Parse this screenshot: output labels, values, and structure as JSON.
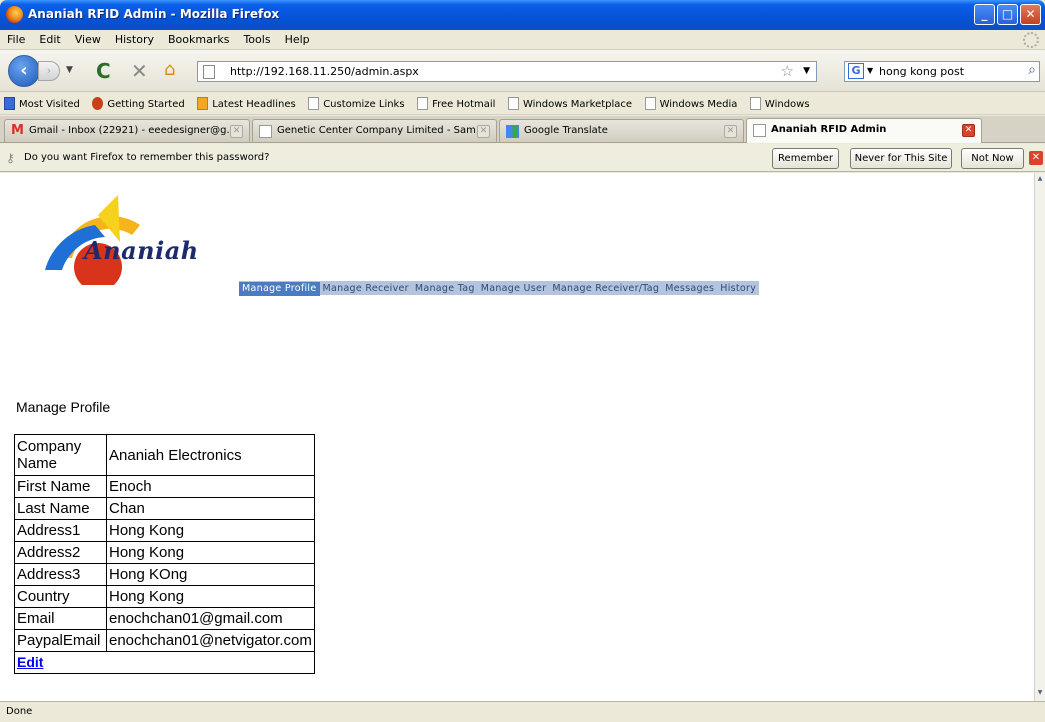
{
  "window": {
    "title": "Ananiah RFID Admin - Mozilla Firefox"
  },
  "menu": [
    "File",
    "Edit",
    "View",
    "History",
    "Bookmarks",
    "Tools",
    "Help"
  ],
  "navbar": {
    "url": "http://192.168.11.250/admin.aspx",
    "search_value": "hong kong post"
  },
  "bookmarks": [
    {
      "label": "Most Visited",
      "icon": "most-visited-icon"
    },
    {
      "label": "Getting Started",
      "icon": "firefox-icon"
    },
    {
      "label": "Latest Headlines",
      "icon": "rss-icon"
    },
    {
      "label": "Customize Links",
      "icon": "page-icon"
    },
    {
      "label": "Free Hotmail",
      "icon": "page-icon"
    },
    {
      "label": "Windows Marketplace",
      "icon": "page-icon"
    },
    {
      "label": "Windows Media",
      "icon": "page-icon"
    },
    {
      "label": "Windows",
      "icon": "page-icon"
    }
  ],
  "tabs": [
    {
      "label": "Gmail - Inbox (22921) - eeedesigner@g...",
      "icon": "gmail-icon",
      "active": false
    },
    {
      "label": "Genetic Center Company Limited - Sam...",
      "icon": "page-icon",
      "active": false
    },
    {
      "label": "Google Translate",
      "icon": "google-translate-icon",
      "active": false
    },
    {
      "label": "Ananiah RFID Admin",
      "icon": "page-icon",
      "active": true
    }
  ],
  "notification": {
    "message": "Do you want Firefox to remember this password?",
    "remember": "Remember",
    "never": "Never for This Site",
    "not_now": "Not Now"
  },
  "site": {
    "logo_text": "Ananiah",
    "nav": [
      "Manage Profile",
      "Manage Receiver",
      "Manage Tag",
      "Manage User",
      "Manage Receiver/Tag",
      "Messages",
      "History"
    ],
    "active_nav": "Manage Profile"
  },
  "profile": {
    "title": "Manage Profile",
    "rows": [
      {
        "label": "Company Name",
        "value": "Ananiah Electronics"
      },
      {
        "label": "First Name",
        "value": "Enoch"
      },
      {
        "label": "Last Name",
        "value": "Chan"
      },
      {
        "label": "Address1",
        "value": "Hong Kong"
      },
      {
        "label": "Address2",
        "value": "Hong Kong"
      },
      {
        "label": "Address3",
        "value": "Hong KOng"
      },
      {
        "label": "Country",
        "value": "Hong Kong"
      },
      {
        "label": "Email",
        "value": "enochchan01@gmail.com"
      },
      {
        "label": "PaypalEmail",
        "value": "enochchan01@netvigator.com"
      }
    ],
    "edit_label": "Edit"
  },
  "status": {
    "text": "Done"
  },
  "colors": {
    "site_nav_bg": "#b3c4dc",
    "site_nav_active": "#4b7bc2",
    "link": "#0000ee"
  }
}
